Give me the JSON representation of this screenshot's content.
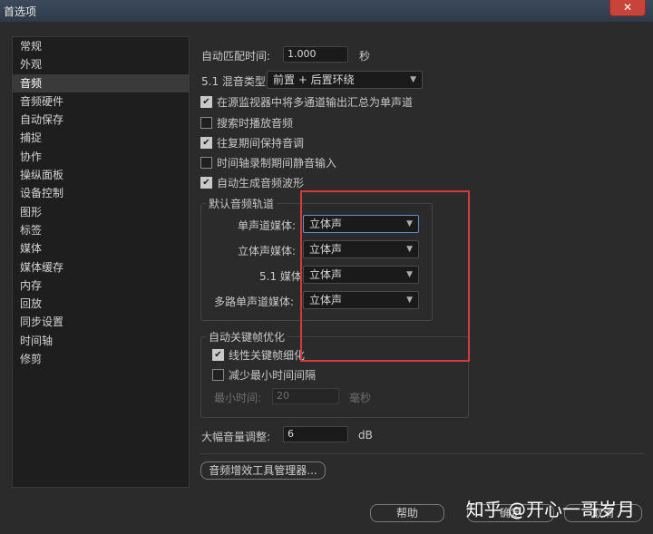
{
  "window": {
    "title": "首选项",
    "close_label": "✕"
  },
  "sidebar": {
    "items": [
      "常规",
      "外观",
      "音频",
      "音频硬件",
      "自动保存",
      "捕捉",
      "协作",
      "操纵面板",
      "设备控制",
      "图形",
      "标签",
      "媒体",
      "媒体缓存",
      "内存",
      "回放",
      "同步设置",
      "时间轴",
      "修剪"
    ],
    "selected": "音频"
  },
  "audio": {
    "auto_match_label": "自动匹配时间:",
    "auto_match_value": "1.000",
    "auto_match_unit": "秒",
    "mix_type_label": "5.1 混音类型:",
    "mix_type_value": "前置 + 后置环绕",
    "checkbox_monitor": {
      "label": "在源监视器中将多通道输出汇总为单声道",
      "checked": true
    },
    "checkbox_scrub": {
      "label": "搜索时播放音频",
      "checked": false
    },
    "checkbox_shuttle": {
      "label": "往复期间保持音调",
      "checked": true
    },
    "checkbox_mute": {
      "label": "时间轴录制期间静音输入",
      "checked": false
    },
    "checkbox_waveform": {
      "label": "自动生成音频波形",
      "checked": true
    }
  },
  "default_tracks": {
    "title": "默认音频轨道",
    "mono_label": "单声道媒体:",
    "mono_value": "立体声",
    "stereo_label": "立体声媒体:",
    "stereo_value": "立体声",
    "surround_label": "5.1 媒体:",
    "surround_value": "立体声",
    "multi_mono_label": "多路单声道媒体:",
    "multi_mono_value": "立体声"
  },
  "keyframe_opt": {
    "title": "自动关键帧优化",
    "linear_label": "线性关键帧细化",
    "linear_checked": true,
    "reduce_label": "减少最小时间间隔",
    "reduce_checked": false,
    "min_time_label": "最小时间:",
    "min_time_value": "20",
    "min_time_unit": "毫秒"
  },
  "gain": {
    "label": "大幅音量调整:",
    "value": "6",
    "unit": "dB"
  },
  "buttons": {
    "plugin_manager": "音频增效工具管理器...",
    "help": "帮助",
    "ok": "确定",
    "cancel": "取消"
  },
  "watermark": "知乎 @开心一哥岁月",
  "colors": {
    "highlight_box": "#d63a3a",
    "focus": "#5a8fd0"
  }
}
